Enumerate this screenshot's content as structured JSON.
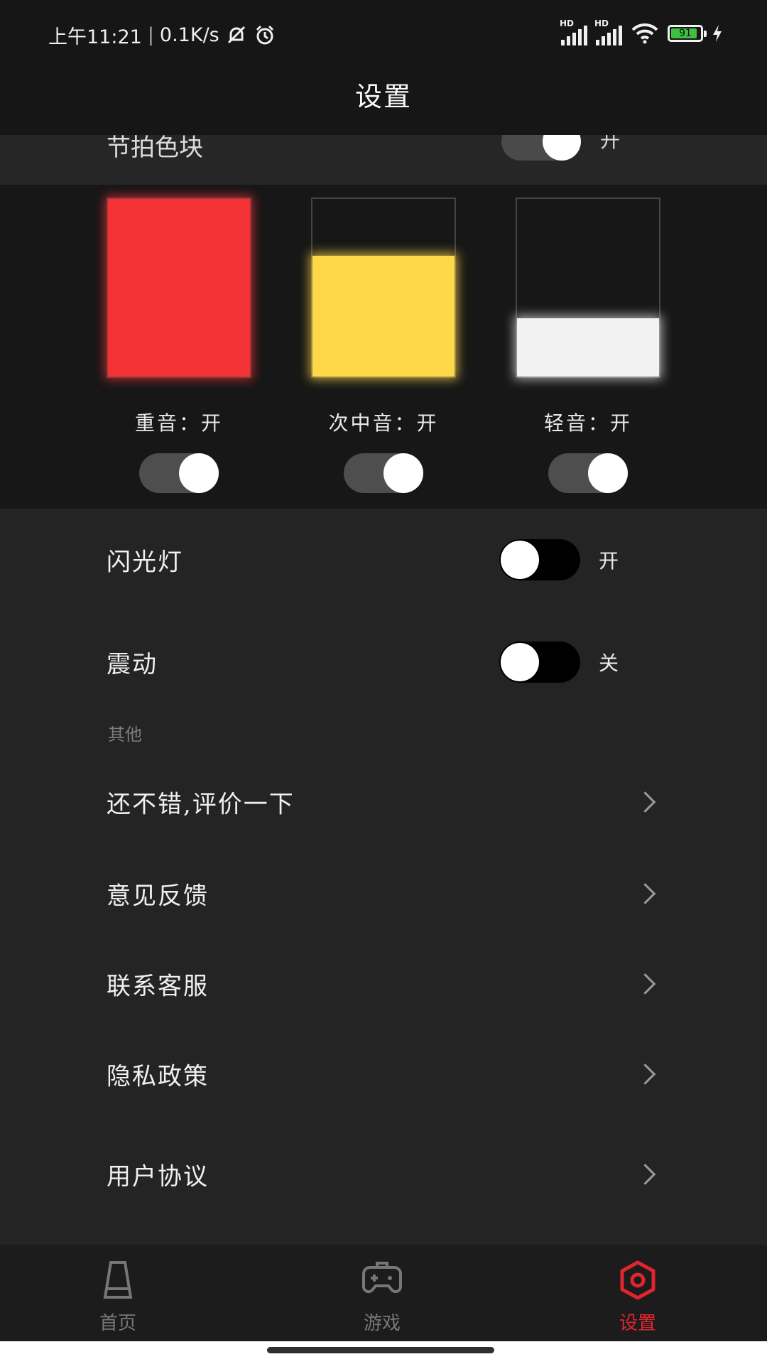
{
  "status_bar": {
    "time": "上午11:21",
    "speed": "0.1K/s",
    "signal_label": "HD",
    "battery": "91"
  },
  "header": {
    "title": "设置"
  },
  "partial_row": {
    "label": "节拍色块",
    "value": "开"
  },
  "beats": [
    {
      "label": "重音：开",
      "fill_level": 1.0,
      "color": "#f23235",
      "on": true
    },
    {
      "label": "次中音：开",
      "fill_level": 0.68,
      "color": "#ffd84a",
      "on": true
    },
    {
      "label": "轻音：开",
      "fill_level": 0.33,
      "color": "#f2f2f2",
      "on": true
    }
  ],
  "toggles": [
    {
      "label": "闪光灯",
      "state": "开"
    },
    {
      "label": "震动",
      "state": "关"
    }
  ],
  "section_other": "其他",
  "links": [
    {
      "label": "还不错,评价一下"
    },
    {
      "label": "意见反馈"
    },
    {
      "label": "联系客服"
    },
    {
      "label": "隐私政策"
    },
    {
      "label": "用户协议"
    }
  ],
  "tabs": [
    {
      "label": "首页",
      "icon": "metronome-icon",
      "active": false
    },
    {
      "label": "游戏",
      "icon": "gamepad-icon",
      "active": false
    },
    {
      "label": "设置",
      "icon": "settings-hexagon-icon",
      "active": true
    }
  ],
  "colors": {
    "accent": "#e0252f",
    "background": "#242424",
    "header": "#161616"
  }
}
